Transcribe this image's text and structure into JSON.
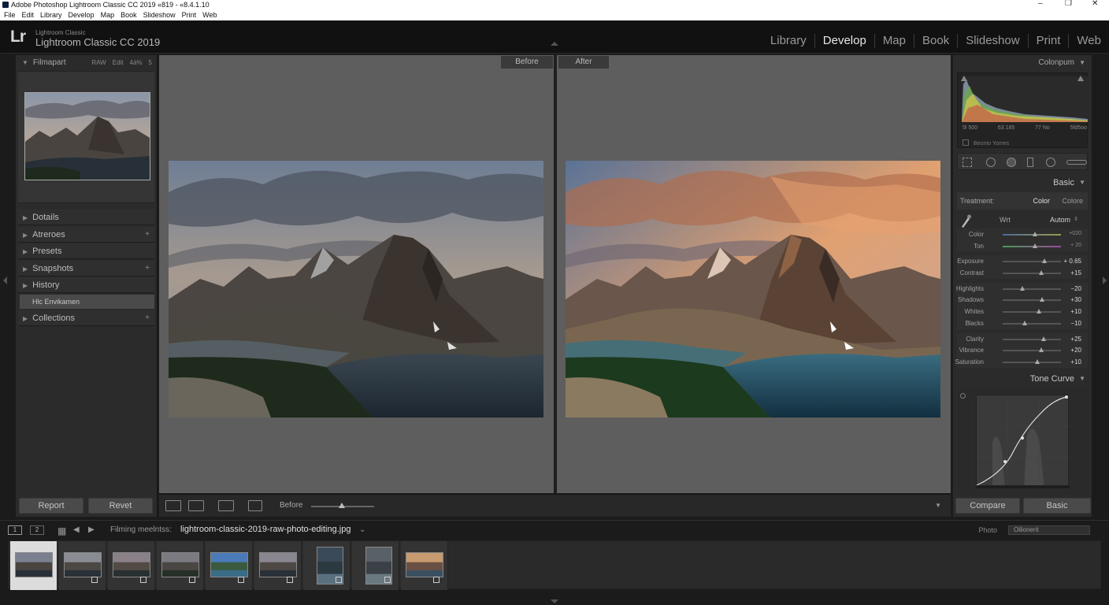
{
  "window": {
    "title": "Adobe Photoshop Lightroom Classic CC 2019 «819 - «8.4.1.10",
    "controls": [
      "–",
      "❐",
      "✕"
    ]
  },
  "menubar": [
    "File",
    "Edit",
    "Library",
    "Develop",
    "Map",
    "Book",
    "Slideshow",
    "Print",
    "Web"
  ],
  "header": {
    "logo": "Lr",
    "subtitle": "Lightroom Classic",
    "app_name": "Lightroom Classic CC 2019",
    "modules": [
      "Library",
      "Develop",
      "Map",
      "Book",
      "Slideshow",
      "Print",
      "Web"
    ],
    "active_module": "Develop"
  },
  "left_panel": {
    "navigator": {
      "label": "Filmapart",
      "tabs": [
        "RAW",
        "Edit",
        "4á%",
        "5"
      ]
    },
    "sections": [
      "Dotails",
      "Atreroes",
      "Presets",
      "Snapshots",
      "History"
    ],
    "history_item": "Hlc Envikamen",
    "collections": "Collections",
    "buttons": {
      "report": "Report",
      "reset": "Revet"
    }
  },
  "center": {
    "before_label": "Before",
    "after_label": "After"
  },
  "toolbar": {
    "before_label": "Before"
  },
  "right_panel": {
    "histogram": {
      "label": "Colonpum",
      "values": [
        "5l 500",
        "63.185",
        "77 No",
        "5fd5oo"
      ],
      "show_original": "Beonto Yomes"
    },
    "basic": {
      "label": "Basic",
      "treatment_label": "Treatment:",
      "treatment_options": [
        "Color",
        "Colore"
      ],
      "wb_label": "Wrt",
      "wb_value": "Autom",
      "color_rows": [
        {
          "label": "Color",
          "value": "+020",
          "pos": 0.56
        },
        {
          "label": "Ton",
          "value": "+ 20",
          "pos": 0.56
        }
      ],
      "tone_sliders": [
        {
          "label": "Exposure",
          "value": "+ 0.65",
          "pos": 0.72
        },
        {
          "label": "Contrast",
          "value": "+15",
          "pos": 0.66
        }
      ],
      "presence_sliders": [
        {
          "label": "Highlights",
          "value": "−20",
          "pos": 0.34
        },
        {
          "label": "Shadows",
          "value": "+30",
          "pos": 0.68
        },
        {
          "label": "Whites",
          "value": "+10",
          "pos": 0.62
        },
        {
          "label": "Blacks",
          "value": "−10",
          "pos": 0.38
        }
      ],
      "detail_sliders": [
        {
          "label": "Clarity",
          "value": "+25",
          "pos": 0.7
        },
        {
          "label": "Vibrance",
          "value": "+20",
          "pos": 0.66
        },
        {
          "label": "Saturation",
          "value": "+10",
          "pos": 0.6
        }
      ]
    },
    "tone_curve": {
      "label": "Tone Curve"
    },
    "buttons": {
      "compare": "Compare",
      "basic": "Basic"
    }
  },
  "filmstrip_bar": {
    "monitor_1": "1",
    "monitor_2": "2",
    "info_label": "Filming meelntss:",
    "filename": "lightroom-classic-2019-raw-photo-editing.jpg",
    "filename_caret": "⌄",
    "photo_label": "Photo",
    "filter_value": "Olilonerit"
  },
  "filmstrip": {
    "count": 9,
    "selected": 0
  },
  "colors": {
    "panel_bg": "#2b2b2b",
    "header_bg": "#111111",
    "viewer_bg": "#5e5e5e",
    "active_module": "#e8e8e8"
  }
}
